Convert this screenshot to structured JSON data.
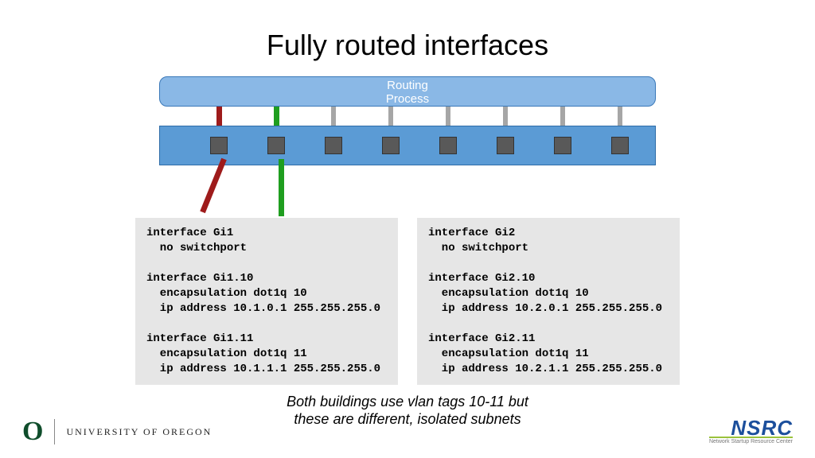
{
  "title": "Fully routed interfaces",
  "routing_label_line1": "Routing",
  "routing_label_line2": "Process",
  "config_left": "interface Gi1\n  no switchport\n\ninterface Gi1.10\n  encapsulation dot1q 10\n  ip address 10.1.0.1 255.255.255.0\n\ninterface Gi1.11\n  encapsulation dot1q 11\n  ip address 10.1.1.1 255.255.255.0",
  "config_right": "interface Gi2\n  no switchport\n\ninterface Gi2.10\n  encapsulation dot1q 10\n  ip address 10.2.0.1 255.255.255.0\n\ninterface Gi2.11\n  encapsulation dot1q 11\n  ip address 10.2.1.1 255.255.255.0",
  "caption_line1": "Both buildings use vlan tags 10-11 but",
  "caption_line2": "these are different, isolated subnets",
  "footer": {
    "uo_logo": "O",
    "uo_text": "UNIVERSITY OF OREGON",
    "nsrc_text": "NSRC",
    "nsrc_sub": "Network Startup Resource Center"
  },
  "ports": [
    64,
    136,
    208,
    280,
    352,
    424,
    496,
    568
  ],
  "colors": {
    "routing_bg": "#8ab8e6",
    "switch_bg": "#5b9bd5",
    "port_bg": "#595959",
    "cable_red": "#9e1b1b",
    "cable_green": "#1f9e1f",
    "cable_grey": "#a6a6a6"
  }
}
